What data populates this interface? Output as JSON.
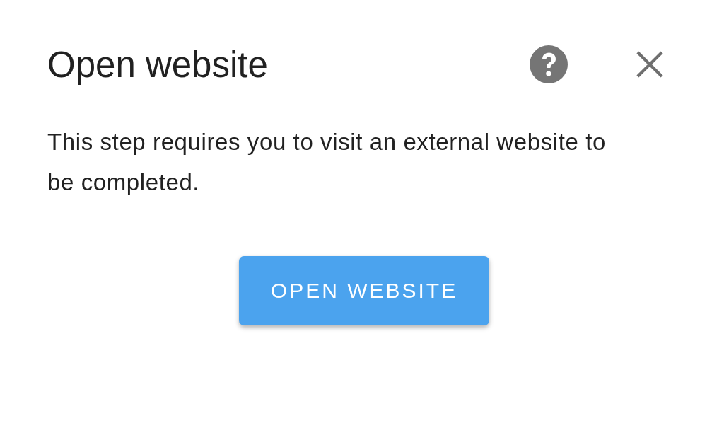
{
  "dialog": {
    "title": "Open website",
    "message": "This step requires you to visit an external website to be completed.",
    "button": "OPEN WEBSITE"
  }
}
